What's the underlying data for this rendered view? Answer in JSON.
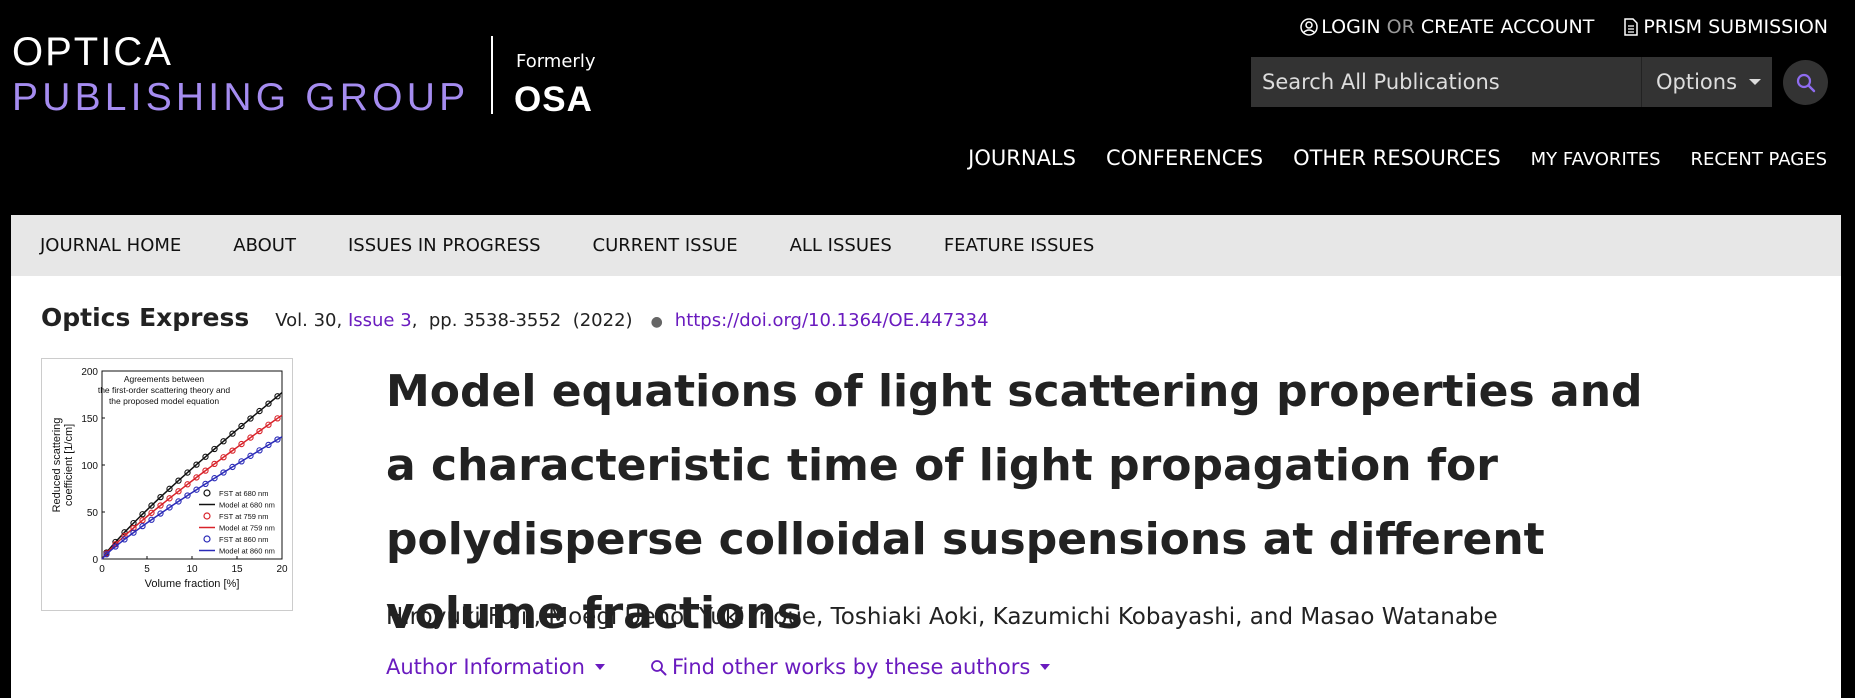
{
  "header": {
    "logo_line1": "OPTICA",
    "logo_line2": "PUBLISHING GROUP",
    "formerly": "Formerly",
    "former_name": "OSA",
    "login": "LOGIN",
    "or": "OR",
    "create_account": "CREATE ACCOUNT",
    "prism": "PRISM SUBMISSION",
    "search_placeholder": "Search All Publications",
    "options_label": "Options",
    "nav": [
      "JOURNALS",
      "CONFERENCES",
      "OTHER RESOURCES",
      "MY FAVORITES",
      "RECENT PAGES"
    ]
  },
  "subnav": [
    "JOURNAL HOME",
    "ABOUT",
    "ISSUES IN PROGRESS",
    "CURRENT ISSUE",
    "ALL ISSUES",
    "FEATURE ISSUES"
  ],
  "article": {
    "journal": "Optics Express",
    "volume": "Vol. 30,",
    "issue": "Issue 3",
    "pages": ",  pp. 3538-3552  (2022)",
    "doi": "https://doi.org/10.1364/OE.447334",
    "title": "Model equations of light scattering properties and a characteristic time of light propagation for polydisperse colloidal suspensions at different volume fractions",
    "authors": "Hiroyuki Fujii, Moegi Ueno, Yuki Inoue, Toshiaki Aoki, Kazumichi Kobayashi, and Masao Watanabe",
    "author_info": "Author Information",
    "find_works": "Find other works by these authors"
  },
  "toc_figure": {
    "annotation": [
      "Agreements between",
      "the first-order scattering theory and",
      "the proposed model equation"
    ],
    "ylabel": [
      "Reduced scattering",
      "coefficient [1/cm]"
    ],
    "xlabel": "Volume fraction [%]",
    "yticks": [
      "0",
      "50",
      "100",
      "150",
      "200"
    ],
    "xticks": [
      "0",
      "5",
      "10",
      "15",
      "20"
    ],
    "legend": [
      "FST at 680 nm",
      "Model at 680 nm",
      "FST at 759 nm",
      "Model at 759 nm",
      "FST at 860 nm",
      "Model at 860 nm"
    ],
    "colors": [
      "#111111",
      "#d8232a",
      "#2b2bb8"
    ]
  }
}
